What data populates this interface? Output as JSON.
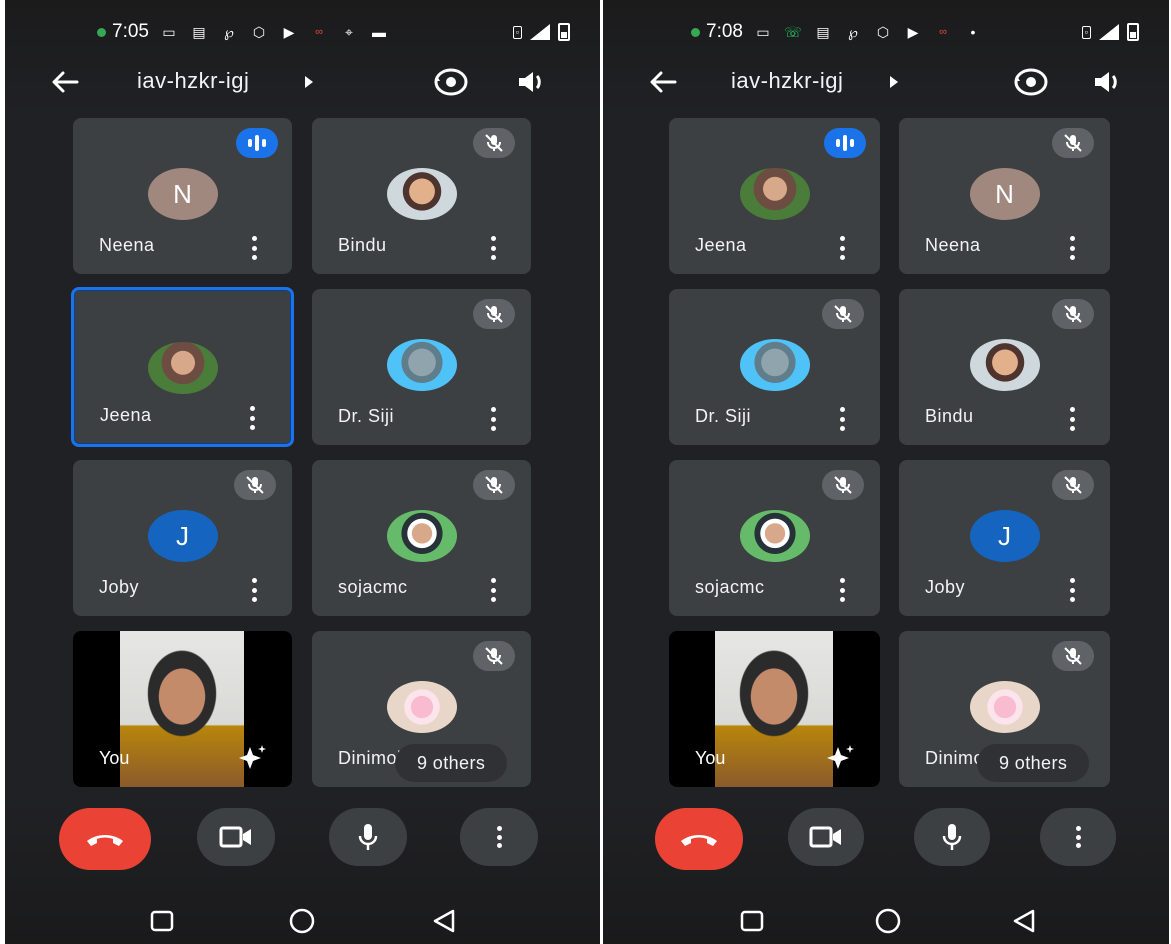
{
  "left_screen": {
    "status": {
      "time": "7:05"
    },
    "meeting_code": "iav-hzkr-igj",
    "tiles": [
      {
        "name": "Neena",
        "avatar_letter": "N"
      },
      {
        "name": "Bindu"
      },
      {
        "name": "Jeena"
      },
      {
        "name": "Dr. Siji"
      },
      {
        "name": "Joby",
        "avatar_letter": "J"
      },
      {
        "name": "sojacmc"
      },
      {
        "name": "You"
      },
      {
        "name": "Dinimol"
      }
    ],
    "others_label": "9 others"
  },
  "right_screen": {
    "status": {
      "time": "7:08"
    },
    "meeting_code": "iav-hzkr-igj",
    "tiles": [
      {
        "name": "Jeena"
      },
      {
        "name": "Neena",
        "avatar_letter": "N"
      },
      {
        "name": "Dr. Siji"
      },
      {
        "name": "Bindu"
      },
      {
        "name": "sojacmc"
      },
      {
        "name": "Joby",
        "avatar_letter": "J"
      },
      {
        "name": "You"
      },
      {
        "name": "Dinimol"
      }
    ],
    "others_label": "9 others"
  },
  "colors": {
    "background": "#202124",
    "tile": "#3c4043",
    "end_call": "#ea4335",
    "speaking": "#1a73e8",
    "active_border": "#1a73e8"
  },
  "icons": {
    "back": "arrow-left-icon",
    "flip_camera": "flip-camera-icon",
    "speaker": "speaker-icon",
    "mic_off": "mic-off-icon",
    "end_call": "phone-hangup-icon",
    "camera": "video-camera-icon",
    "mic": "mic-icon",
    "more": "more-vert-icon",
    "effects": "sparkle-icon"
  }
}
